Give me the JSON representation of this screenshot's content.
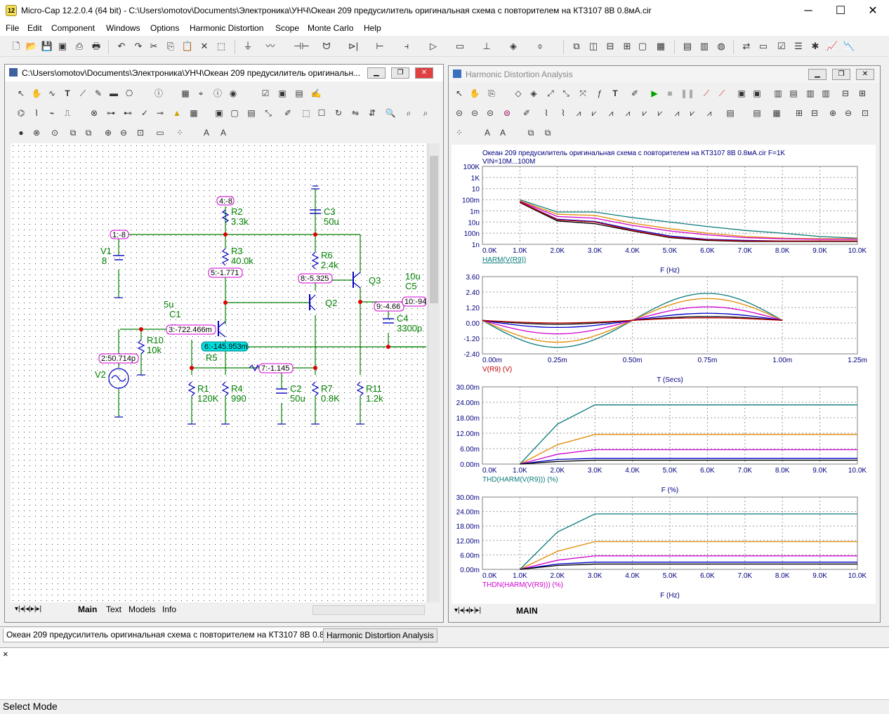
{
  "app": {
    "title": "Micro-Cap 12.2.0.4 (64 bit) - C:\\Users\\omotov\\Documents\\Электроника\\УНЧ\\Океан 209 предусилитель оригинальная схема с повторителем на КТ3107 8В 0.8мА.cir",
    "icon": "12"
  },
  "window_controls": {
    "minimize": "─",
    "maximize": "☐",
    "close": "✕"
  },
  "menu": [
    "File",
    "Edit",
    "Component",
    "Windows",
    "Options",
    "Harmonic Distortion",
    "Scope",
    "Monte Carlo",
    "Help"
  ],
  "schematic": {
    "title": "C:\\Users\\omotov\\Documents\\Электроника\\УНЧ\\Океан 209 предусилитель оригинальн...",
    "tabs": [
      "Main",
      "Text",
      "Models",
      "Info"
    ],
    "active_tab": "Main",
    "components": {
      "R2": "R2",
      "R2v": "3.3k",
      "R3": "R3",
      "R3v": "40.0k",
      "R6": "R6",
      "R6v": "2.4k",
      "C3": "C3",
      "C3v": "50u",
      "V1": "V1",
      "V1v": "8",
      "Q2": "Q2",
      "Q3": "Q3",
      "C1": "C1",
      "C1v": "5u",
      "C5": "C5",
      "C5v": "10u",
      "C4": "C4",
      "C4v": "3300p",
      "R10": "R10",
      "R10v": "10k",
      "R5": "R5",
      "V2": "V2",
      "R1": "R1",
      "R1v": "120K",
      "R4": "R4",
      "R4v": "990",
      "C2": "C2",
      "C2v": "50u",
      "R7": "R7",
      "R7v": "0.8K",
      "R11": "R11",
      "R11v": "1.2k"
    },
    "nodes": {
      "n4": "4:-8",
      "n1": "1:-8",
      "n5": "5:-1.771",
      "n8": "8:-5.325",
      "n9": "9:-4.66",
      "n10": "10:-94",
      "n3": "3:-722.466m",
      "n6": "6:-145.953m",
      "n2": "2:50.714p",
      "n7": "7:-1.145"
    }
  },
  "analysis": {
    "title": "Harmonic Distortion Analysis",
    "tab": "MAIN",
    "header": "Океан 209 предусилитель оригинальная схема с повторителем на КТ3107 8В 0.8мА.cir F=1K",
    "subheader": "VIN=10M...100M"
  },
  "chart_data": [
    {
      "type": "line",
      "title": "",
      "ylabel": "HARM(V(R9))",
      "xlabel": "F (Hz)",
      "yscale": "log",
      "yticks": [
        "100K",
        "1K",
        "10",
        "100m",
        "1m",
        "10u",
        "100n",
        "1n"
      ],
      "xticks": [
        "0.0K",
        "1.0K",
        "2.0K",
        "3.0K",
        "4.0K",
        "5.0K",
        "6.0K",
        "7.0K",
        "8.0K",
        "9.0K",
        "10.0K"
      ],
      "xlim": [
        0,
        10000
      ],
      "ylog_range": [
        -9,
        5
      ],
      "x": [
        1000,
        2000,
        3000,
        4000,
        5000,
        6000,
        7000,
        8000,
        9000,
        10000
      ],
      "series": [
        {
          "color": "#0a7a7a",
          "values": [
            -1.0,
            -3.2,
            -3.2,
            -4.2,
            -5.0,
            -5.8,
            -6.5,
            -7.0,
            -7.6,
            -7.9
          ]
        },
        {
          "color": "#e08a00",
          "values": [
            -1.2,
            -3.6,
            -3.8,
            -5.2,
            -6.2,
            -7.0,
            -7.6,
            -7.9,
            -8.0,
            -8.0
          ]
        },
        {
          "color": "#d000d0",
          "values": [
            -1.3,
            -4.0,
            -4.3,
            -5.6,
            -6.6,
            -7.3,
            -7.8,
            -8.0,
            -8.1,
            -8.1
          ]
        },
        {
          "color": "#0000c8",
          "values": [
            -1.4,
            -4.5,
            -4.9,
            -6.3,
            -7.5,
            -8.1,
            -8.3,
            -8.4,
            -8.4,
            -8.4
          ]
        },
        {
          "color": "#000000",
          "values": [
            -1.5,
            -4.8,
            -5.3,
            -6.6,
            -7.8,
            -8.3,
            -8.5,
            -8.5,
            -8.5,
            -8.5
          ]
        },
        {
          "color": "#c00000",
          "values": [
            -1.4,
            -4.6,
            -5.0,
            -6.5,
            -7.7,
            -8.2,
            -8.4,
            -8.4,
            -8.4,
            -8.4
          ]
        }
      ]
    },
    {
      "type": "line",
      "title": "",
      "ylabel": "V(R9) (V)",
      "xlabel": "T (Secs)",
      "yticks": [
        "3.60",
        "2.40",
        "1.20",
        "0.00",
        "-1.20",
        "-2.40"
      ],
      "xticks": [
        "0.00m",
        "0.25m",
        "0.50m",
        "0.75m",
        "1.00m",
        "1.25m"
      ],
      "xlim": [
        0,
        1.25
      ],
      "ylim": [
        -2.4,
        3.6
      ],
      "amplitudes": [
        2.1,
        1.7,
        1.05,
        0.55,
        0.3,
        0.2
      ],
      "colors": [
        "#0a7a7a",
        "#e08a00",
        "#d000d0",
        "#0000c8",
        "#000000",
        "#c00000"
      ]
    },
    {
      "type": "line",
      "title": "",
      "ylabel": "THD(HARM(V(R9))) (%)",
      "xlabel": "F (%)",
      "yticks": [
        "30.00m",
        "24.00m",
        "18.00m",
        "12.00m",
        "6.00m",
        "0.00m"
      ],
      "xticks": [
        "0.0K",
        "1.0K",
        "2.0K",
        "3.0K",
        "4.0K",
        "5.0K",
        "6.0K",
        "7.0K",
        "8.0K",
        "9.0K",
        "10.0K"
      ],
      "xlim": [
        0,
        10000
      ],
      "ylim": [
        0,
        30
      ],
      "x": [
        1000,
        2000,
        3000,
        10000
      ],
      "series": [
        {
          "color": "#0a7a7a",
          "values": [
            0,
            15.5,
            23,
            23
          ]
        },
        {
          "color": "#e08a00",
          "values": [
            0,
            7.5,
            11.5,
            11.5
          ]
        },
        {
          "color": "#d000d0",
          "values": [
            0,
            3.8,
            5.6,
            5.6
          ]
        },
        {
          "color": "#0000c8",
          "values": [
            0,
            1.8,
            2.2,
            2.2
          ]
        },
        {
          "color": "#000000",
          "values": [
            0,
            1.0,
            1.5,
            1.5
          ]
        }
      ]
    },
    {
      "type": "line",
      "title": "",
      "ylabel": "THDN(HARM(V(R9))) (%)",
      "xlabel": "F (Hz)",
      "yticks": [
        "30.00m",
        "24.00m",
        "18.00m",
        "12.00m",
        "6.00m",
        "0.00m"
      ],
      "xticks": [
        "0.0K",
        "1.0K",
        "2.0K",
        "3.0K",
        "4.0K",
        "5.0K",
        "6.0K",
        "7.0K",
        "8.0K",
        "9.0K",
        "10.0K"
      ],
      "xlim": [
        0,
        10000
      ],
      "ylim": [
        0,
        30
      ],
      "x": [
        1000,
        2000,
        3000,
        10000
      ],
      "series": [
        {
          "color": "#0a7a7a",
          "values": [
            0,
            15.5,
            23,
            23
          ]
        },
        {
          "color": "#e08a00",
          "values": [
            0,
            7.5,
            11.5,
            11.5
          ]
        },
        {
          "color": "#d000d0",
          "values": [
            0,
            3.8,
            5.6,
            5.6
          ]
        },
        {
          "color": "#0000c8",
          "values": [
            0,
            2.2,
            3.0,
            3.0
          ]
        },
        {
          "color": "#000000",
          "values": [
            0,
            1.6,
            2.2,
            2.2
          ]
        }
      ]
    }
  ],
  "doc_tabs": [
    "Океан 209 предусилитель оригинальная схема с повторителем на КТ3107 8В 0.8мА.cir",
    "Harmonic Distortion Analysis"
  ],
  "output_close": "×",
  "status": "Select Mode",
  "colors": {
    "wire": "#008000",
    "node_label": "#d000d0",
    "node_bg": "#00e0e0",
    "junction": "#e00000",
    "part": "#0000c0",
    "grid_dot": "#333333",
    "axis_text": "#000080"
  }
}
